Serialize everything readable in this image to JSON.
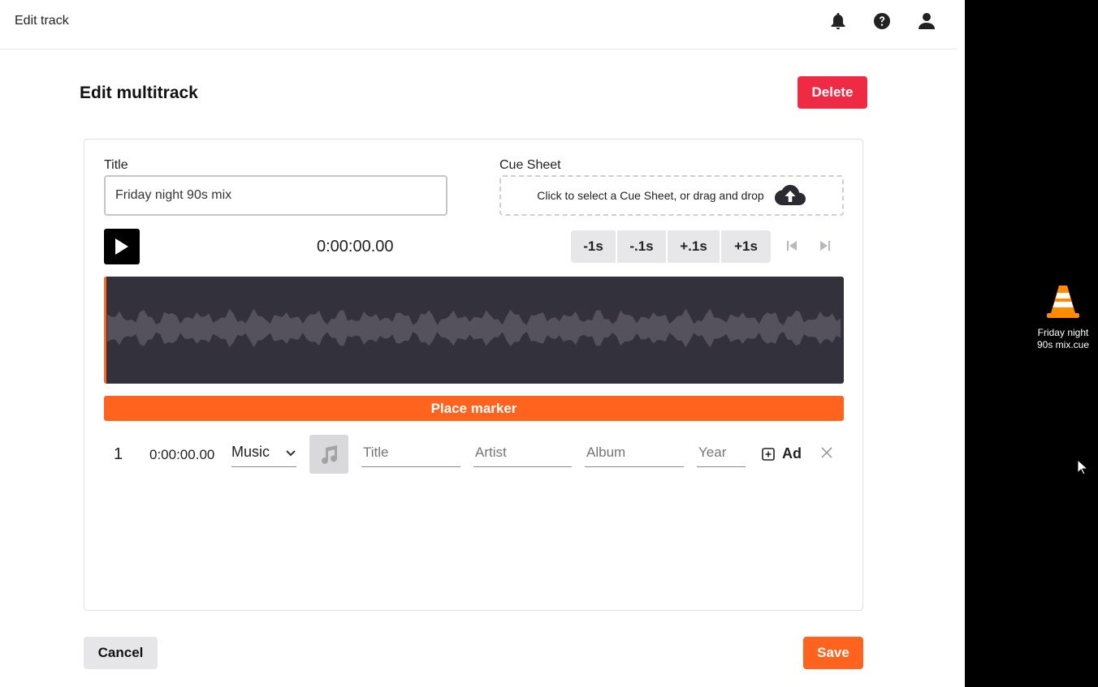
{
  "window": {
    "title": "Edit track"
  },
  "topbar_icons": [
    "bell-icon",
    "help-icon",
    "user-icon"
  ],
  "page": {
    "heading": "Edit multitrack",
    "delete_label": "Delete"
  },
  "form": {
    "title_label": "Title",
    "title_value": "Friday night 90s mix",
    "cue_label": "Cue Sheet",
    "cue_prompt": "Click to select a Cue Sheet, or drag and drop"
  },
  "player": {
    "timecode": "0:00:00.00",
    "seek_buttons": [
      "-1s",
      "-.1s",
      "+.1s",
      "+1s"
    ]
  },
  "marker_label": "Place marker",
  "tracks": [
    {
      "index": "1",
      "time": "0:00:00.00",
      "type": "Music",
      "title_placeholder": "Title",
      "artist_placeholder": "Artist",
      "album_placeholder": "Album",
      "year_placeholder": "Year",
      "add_label": "Ad"
    }
  ],
  "footer": {
    "cancel_label": "Cancel",
    "save_label": "Save"
  },
  "desktop": {
    "file_label": "Friday night 90s mix.cue"
  },
  "colors": {
    "accent": "#ff631e",
    "danger": "#ee2a45",
    "waveform_bg": "#33313b",
    "waveform_fill": "#55525d"
  }
}
